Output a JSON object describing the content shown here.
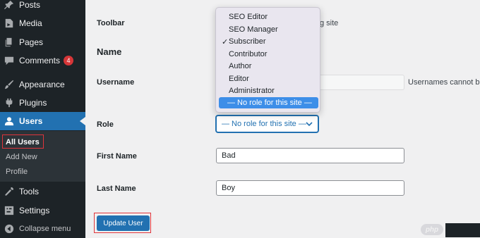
{
  "sidebar": {
    "items": [
      {
        "name": "menu-item-posts",
        "icon": "thumbtack-icon",
        "label": "Posts"
      },
      {
        "name": "menu-item-media",
        "icon": "media-icon",
        "label": "Media"
      },
      {
        "name": "menu-item-pages",
        "icon": "pages-icon",
        "label": "Pages"
      },
      {
        "name": "menu-item-comments",
        "icon": "comments-icon",
        "label": "Comments",
        "badge": "4"
      },
      {
        "name": "menu-item-appearance",
        "icon": "paintbrush-icon",
        "label": "Appearance"
      },
      {
        "name": "menu-item-plugins",
        "icon": "plugin-icon",
        "label": "Plugins"
      },
      {
        "name": "menu-item-users",
        "icon": "user-icon",
        "label": "Users"
      },
      {
        "name": "menu-item-tools",
        "icon": "wrench-icon",
        "label": "Tools"
      },
      {
        "name": "menu-item-settings",
        "icon": "settings-icon",
        "label": "Settings"
      },
      {
        "name": "menu-item-collapse",
        "icon": "collapse-icon",
        "label": "Collapse menu"
      }
    ],
    "submenu": [
      "All Users",
      "Add New",
      "Profile"
    ]
  },
  "form": {
    "toolbar_label": "Toolbar",
    "toolbar_text": "g site",
    "name_heading": "Name",
    "username_label": "Username",
    "username_note": "Usernames cannot be",
    "role_label": "Role",
    "role_value": "— No role for this site —",
    "first_name_label": "First Name",
    "first_name_value": "Bad",
    "last_name_label": "Last Name",
    "last_name_value": "Boy",
    "update_button": "Update User"
  },
  "role_dropdown": {
    "options": [
      "SEO Editor",
      "SEO Manager",
      "Subscriber",
      "Contributor",
      "Author",
      "Editor",
      "Administrator",
      "— No role for this site —"
    ],
    "checked": "Subscriber",
    "highlighted": "— No role for this site —"
  },
  "watermark": {
    "text": "php"
  },
  "colors": {
    "sidebar_bg": "#1d2327",
    "accent": "#2271b1",
    "highlight_box": "#e0343b",
    "badge": "#d63638",
    "dropdown_selected": "#3d8ee8"
  }
}
